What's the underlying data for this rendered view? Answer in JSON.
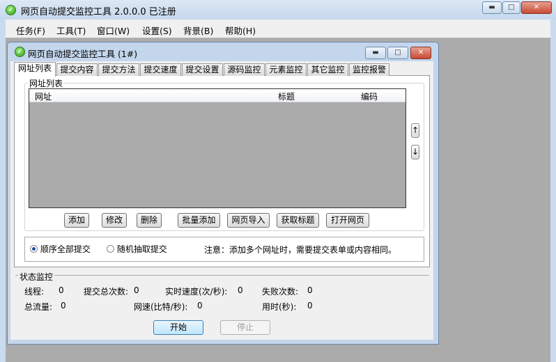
{
  "app": {
    "title": "网页自动提交监控工具 2.0.0.0  已注册"
  },
  "menu": [
    "任务(F)",
    "工具(T)",
    "窗口(W)",
    "设置(S)",
    "背景(B)",
    "帮助(H)"
  ],
  "child": {
    "title": "网页自动提交监控工具  (1#)"
  },
  "tabs": [
    "网址列表",
    "提交内容",
    "提交方法",
    "提交速度",
    "提交设置",
    "源码监控",
    "元素监控",
    "其它监控",
    "监控报警"
  ],
  "url_group": {
    "label": "网址列表",
    "columns": [
      "网址",
      "标题",
      "编码"
    ],
    "rows": []
  },
  "buttons": {
    "add": "添加",
    "edit": "修改",
    "delete": "删除",
    "batch_add": "批量添加",
    "import": "网页导入",
    "get_title": "获取标题",
    "open": "打开网页",
    "up": "↑",
    "down": "↓"
  },
  "mode": {
    "sequential": "顺序全部提交",
    "random": "随机抽取提交",
    "selected": "sequential",
    "note": "注意：添加多个网址时，需要提交表单或内容相同。"
  },
  "status": {
    "label": "状态监控",
    "threads_label": "线程:",
    "threads": "0",
    "total_label": "提交总次数:",
    "total": "0",
    "speed_label": "实时速度(次/秒):",
    "speed": "0",
    "fail_label": "失败次数:",
    "fail": "0",
    "traffic_label": "总流量:",
    "traffic": "0",
    "net_label": "网速(比特/秒):",
    "net": "0",
    "time_label": "用时(秒):",
    "time": "0"
  },
  "actions": {
    "start": "开始",
    "stop": "停止"
  }
}
